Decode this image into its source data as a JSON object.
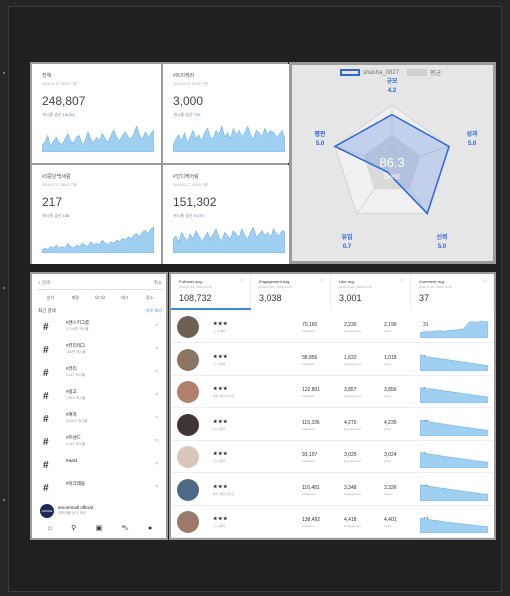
{
  "stats": [
    {
      "title": "전체",
      "date": "2019-02-27 08:00 기준",
      "value": "248,807",
      "sub_label": "게시물 생산",
      "sub_value": "15,031",
      "spark": [
        4,
        5,
        9,
        3,
        6,
        8,
        5,
        4,
        7,
        10,
        6,
        5,
        8,
        9,
        4,
        6,
        11,
        7,
        5,
        8,
        6,
        10,
        7,
        5,
        9,
        12,
        8,
        6,
        9,
        11,
        8,
        7,
        10,
        14,
        9,
        7,
        11,
        8,
        10,
        12
      ]
    },
    {
      "title": "#트리헤라",
      "date": "2019-02-27 08:00 기준",
      "value": "3,000",
      "sub_label": "게시물 생산",
      "sub_value": "720",
      "spark": [
        3,
        6,
        8,
        5,
        9,
        4,
        7,
        10,
        6,
        8,
        5,
        9,
        11,
        7,
        6,
        10,
        8,
        12,
        7,
        9,
        6,
        11,
        8,
        10,
        7,
        9,
        12,
        8,
        6,
        10,
        9,
        7,
        11,
        8,
        10,
        9,
        7,
        8,
        10,
        6
      ]
    },
    {
      "title": "#3중단백세럼",
      "date": "2019-02-27 08:00 기준",
      "value": "217",
      "sub_label": "게시물 생산",
      "sub_value": "188",
      "spark": [
        2,
        3,
        2,
        4,
        3,
        5,
        3,
        4,
        3,
        6,
        4,
        3,
        5,
        4,
        6,
        5,
        4,
        7,
        5,
        6,
        5,
        8,
        6,
        5,
        7,
        6,
        8,
        7,
        9,
        8,
        10,
        9,
        11,
        12,
        10,
        13,
        14,
        12,
        15,
        16
      ]
    },
    {
      "title": "#인디케어링",
      "date": "2019-02-27 08:00 기준",
      "value": "151,302",
      "sub_label": "게시물 생산",
      "sub_value": "9,479",
      "spark": [
        8,
        10,
        6,
        12,
        9,
        7,
        11,
        8,
        13,
        10,
        7,
        9,
        12,
        8,
        11,
        14,
        9,
        7,
        12,
        10,
        8,
        13,
        11,
        9,
        14,
        10,
        8,
        12,
        15,
        9,
        11,
        13,
        10,
        12,
        9,
        14,
        11,
        10,
        13,
        12
      ]
    }
  ],
  "radar": {
    "legend_primary": "shasha_0827",
    "legend_secondary": "평균",
    "score": "86.3",
    "score_label": "Best",
    "axes": [
      {
        "name": "규모",
        "value": "4.2",
        "v": 4.2
      },
      {
        "name": "성과",
        "value": "5.0",
        "v": 5.0
      },
      {
        "name": "신뢰",
        "value": "5.0",
        "v": 5.0
      },
      {
        "name": "유입",
        "value": "0.7",
        "v": 0.7
      },
      {
        "name": "평판",
        "value": "5.0",
        "v": 5.0
      }
    ],
    "avg": [
      2.5,
      2.5,
      2.5,
      2.5,
      2.5
    ],
    "max": 5
  },
  "mobile": {
    "search_placeholder": "검색",
    "cancel": "취소",
    "tabs": [
      "인기",
      "계정",
      "오디오",
      "태그",
      "장소"
    ],
    "recent_title": "최근 검색",
    "recent_clear": "모두 보기",
    "tags": [
      {
        "name": "#맨스키그룸",
        "count": "3,744만 게시물"
      },
      {
        "name": "#뷰티테그",
        "count": "164만 게시물"
      },
      {
        "name": "#뷰티",
        "count": "3,117 게시물"
      },
      {
        "name": "#광고",
        "count": "1,815 게시물"
      },
      {
        "name": "#여자",
        "count": "24,919 게시물"
      },
      {
        "name": "#트렌드",
        "count": "4,412 게시물"
      },
      {
        "name": "#aold",
        "count": ""
      },
      {
        "name": "#아크레올",
        "count": ""
      }
    ],
    "account_name": "amoremall.official",
    "account_sub": "아모레몰 공식 계정"
  },
  "metrics": [
    {
      "label": "Follower avg.",
      "date": "2019.01.26 - 2019.02.26",
      "value": "108,732"
    },
    {
      "label": "Engagement avg.",
      "date": "2019.01.26 - 2019.02.26",
      "value": "3,038"
    },
    {
      "label": "Like avg.",
      "date": "2019.01.26 - 2019.02.26",
      "value": "3,001"
    },
    {
      "label": "Comment avg.",
      "date": "2019.01.26 - 2019.02.26",
      "value": "37"
    }
  ],
  "col_labels": {
    "followers": "Followers",
    "engagement": "Engagement",
    "likes": "Likes",
    "comments": "Comments"
  },
  "influencers": [
    {
      "name": "★★★",
      "sub": "스·니세대",
      "followers": "70,160",
      "engagement": "2,230",
      "likes": "2,199",
      "comments": "31",
      "avatar": "#6d6154",
      "trend": [
        0.3,
        0.35,
        0.32,
        0.4,
        0.38,
        0.42,
        0.45,
        0.5,
        0.9,
        0.88,
        0.92,
        0.9
      ]
    },
    {
      "name": "★★★",
      "sub": "스·니세대",
      "followers": "38,856",
      "engagement": "1,622",
      "likes": "1,018",
      "comments": "4",
      "avatar": "#8a7560",
      "trend": [
        0.9,
        0.8,
        0.75,
        0.7,
        0.65,
        0.6,
        0.55,
        0.5,
        0.45,
        0.4,
        0.35,
        0.3
      ]
    },
    {
      "name": "★★★",
      "sub": "뷰티·패션·라이프",
      "followers": "122,801",
      "engagement": "3,857",
      "likes": "3,856",
      "comments": "1",
      "avatar": "#b0806a",
      "trend": [
        0.85,
        0.8,
        0.78,
        0.72,
        0.68,
        0.62,
        0.58,
        0.52,
        0.48,
        0.42,
        0.38,
        0.34
      ]
    },
    {
      "name": "★★★",
      "sub": "스·니세대",
      "followers": "115,336",
      "engagement": "4,270",
      "likes": "4,235",
      "comments": "35",
      "avatar": "#3f3633",
      "trend": [
        0.88,
        0.82,
        0.76,
        0.7,
        0.66,
        0.6,
        0.55,
        0.5,
        0.46,
        0.4,
        0.36,
        0.32
      ]
    },
    {
      "name": "★★★",
      "sub": "스·니세대",
      "followers": "93,197",
      "engagement": "3,025",
      "likes": "3,024",
      "comments": "1",
      "avatar": "#d8c5bb",
      "trend": [
        0.86,
        0.8,
        0.75,
        0.7,
        0.64,
        0.6,
        0.55,
        0.5,
        0.45,
        0.4,
        0.36,
        0.32
      ]
    },
    {
      "name": "★★★",
      "sub": "뷰티·패션·라이프",
      "followers": "116,481",
      "engagement": "3,348",
      "likes": "3,326",
      "comments": "22",
      "avatar": "#4d6a84",
      "trend": [
        0.9,
        0.85,
        0.8,
        0.74,
        0.7,
        0.64,
        0.6,
        0.54,
        0.5,
        0.45,
        0.4,
        0.36
      ]
    },
    {
      "name": "★★★",
      "sub": "스·니세대",
      "followers": "138,492",
      "engagement": "4,418",
      "likes": "4,401",
      "comments": "17",
      "avatar": "#9c7a6a",
      "trend": [
        0.82,
        0.78,
        0.72,
        0.68,
        0.62,
        0.58,
        0.54,
        0.5,
        0.46,
        0.42,
        0.38,
        0.34
      ]
    }
  ],
  "colors": {
    "accent": "#3a86e6",
    "area": "#9fd0f2",
    "area_stroke": "#5aa8e6",
    "radar_fill": "#6f95e6"
  }
}
